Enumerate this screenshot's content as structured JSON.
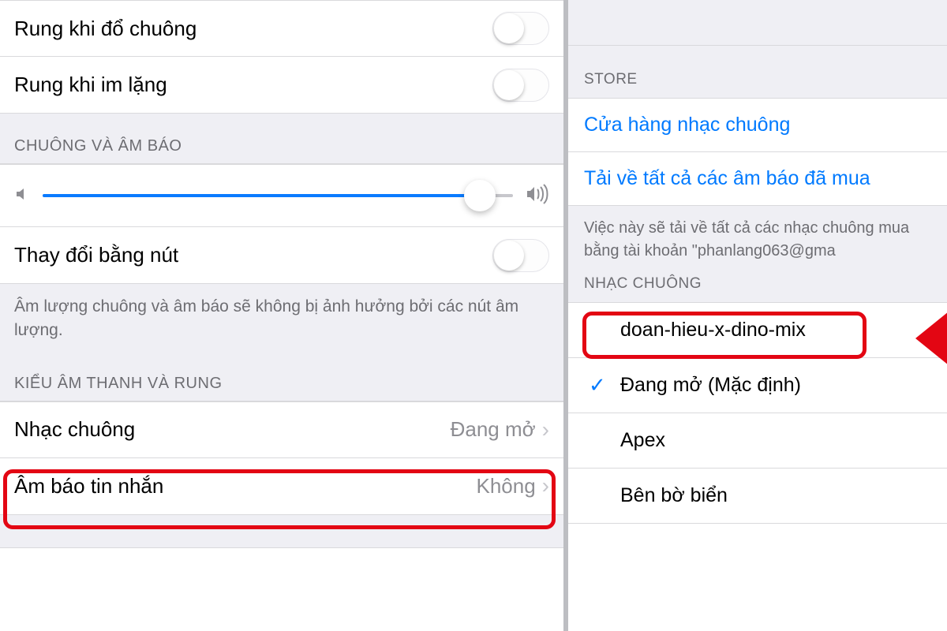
{
  "left": {
    "vibrate_ring": "Rung khi đổ chuông",
    "vibrate_silent": "Rung khi im lặng",
    "section_ringer": "CHUÔNG VÀ ÂM BÁO",
    "change_with_buttons": "Thay đổi bằng nút",
    "volume_note": "Âm lượng chuông và âm báo sẽ không bị ảnh hưởng bởi các nút âm lượng.",
    "section_sounds": "KIỂU ÂM THANH VÀ RUNG",
    "ringtone_label": "Nhạc chuông",
    "ringtone_value": "Đang mở",
    "texttone_label": "Âm báo tin nhắn",
    "texttone_value": "Không",
    "slider_percent": 93
  },
  "right": {
    "section_store": "STORE",
    "store_link": "Cửa hàng nhạc chuông",
    "download_all": "Tải về tất cả các âm báo đã mua",
    "download_note": "Việc này sẽ tải về tất cả các nhạc chuông mua bằng tài khoản \"phanlang063@gma",
    "section_ringtone": "NHẠC CHUÔNG",
    "custom_track": "doan-hieu-x-dino-mix",
    "default_track": "Đang mở (Mặc định)",
    "options": [
      "Apex",
      "Bên bờ biển"
    ]
  }
}
